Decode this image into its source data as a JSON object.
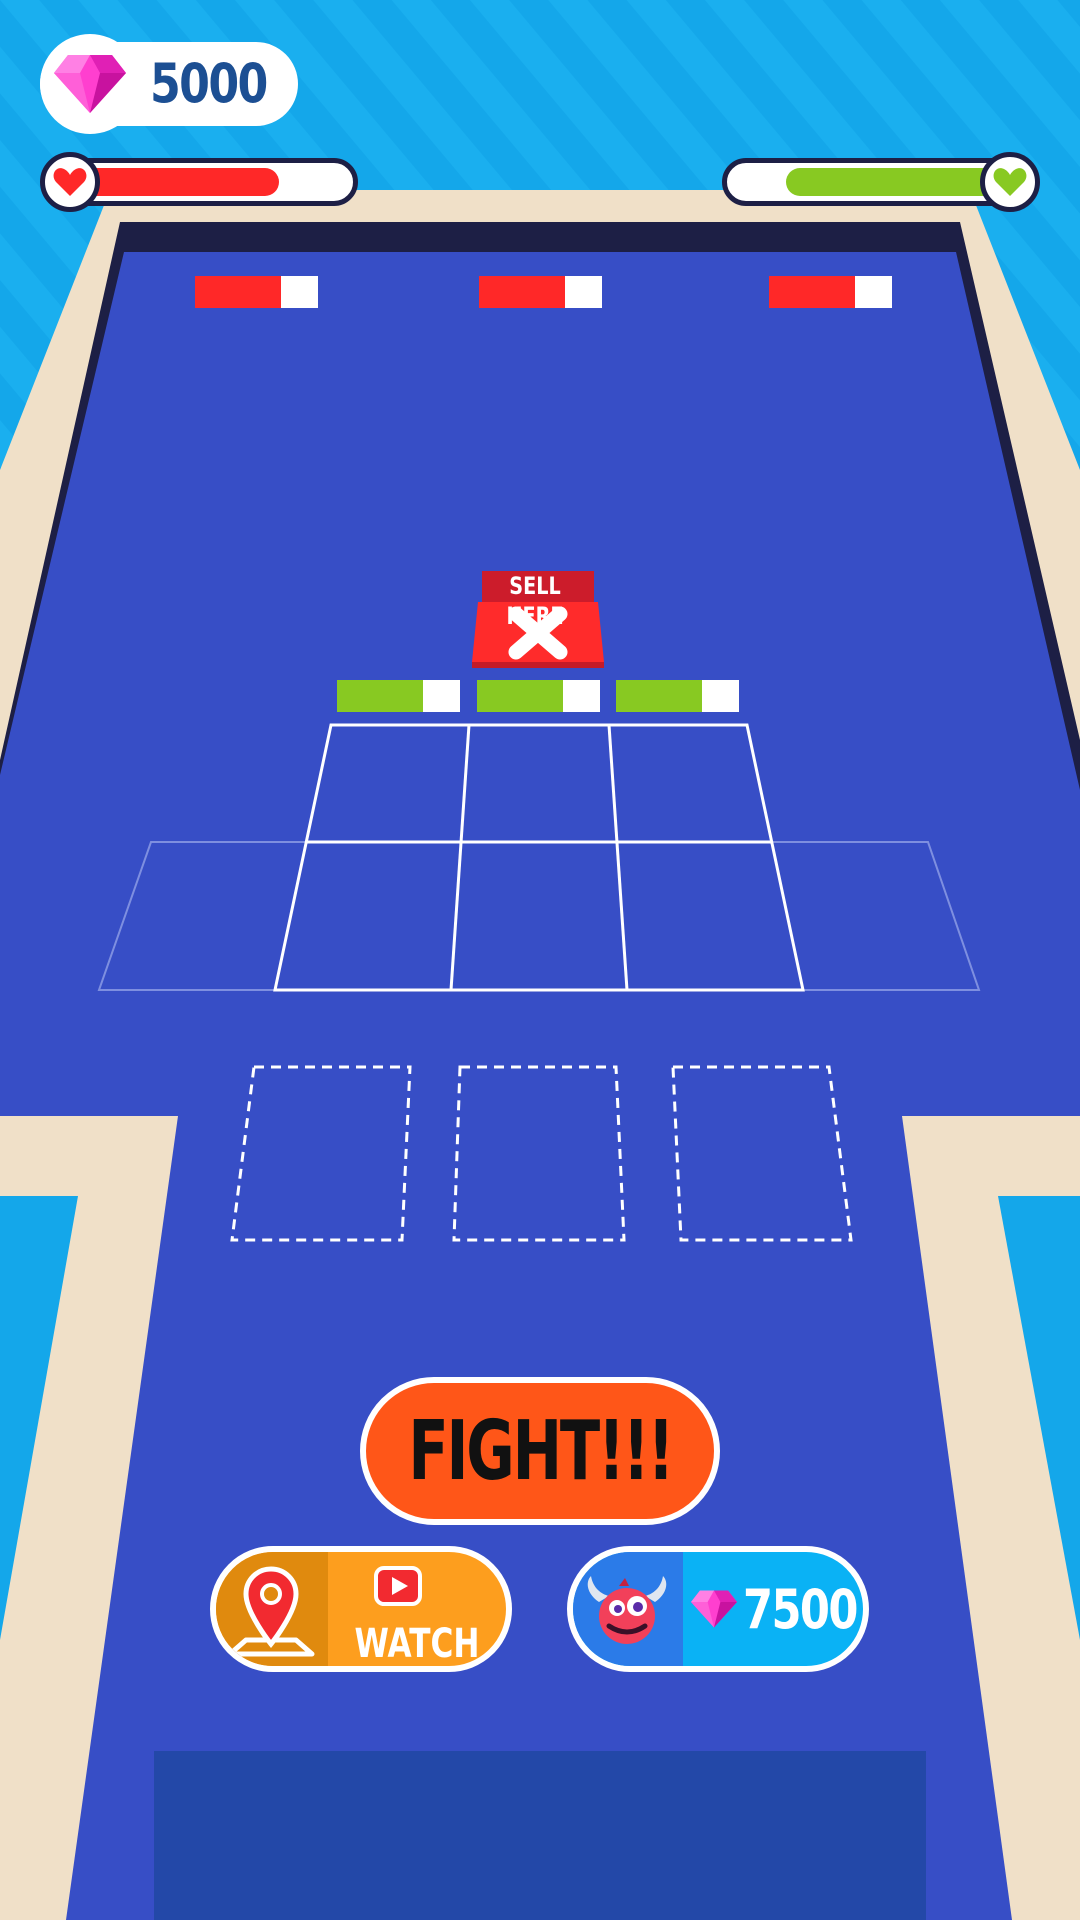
{
  "hud": {
    "gems": "5000",
    "gem_icon": "pink-diamond-icon",
    "player_heart_icon": "red-heart-icon",
    "enemy_heart_icon": "green-heart-icon",
    "player_health": 0.78,
    "enemy_health": 0.82
  },
  "board": {
    "enemy_slots": [
      {
        "health": 0.7
      },
      {
        "health": 0.7
      },
      {
        "health": 0.7
      }
    ],
    "ally_slots": [
      {
        "health": 0.7
      },
      {
        "health": 0.7
      },
      {
        "health": 0.7
      }
    ],
    "sell_sign": "SELL HERE",
    "sell_icon": "x-icon"
  },
  "buttons": {
    "fight_label": "FIGHT!!!",
    "watch_label": "WATCH",
    "watch_icons": [
      "map-pin-icon",
      "video-play-icon"
    ],
    "buy_price": "7500",
    "buy_icons": [
      "monster-icon",
      "pink-diamond-icon"
    ]
  },
  "colors": {
    "sky": "#14a7ea",
    "table_border": "#f0e0c8",
    "table": "#374ec6",
    "enemy_red": "#ff2828",
    "ally_green": "#88c922",
    "fight": "#ff5618",
    "watch": "#fd9e1e",
    "buy": "#0ab2f5"
  }
}
